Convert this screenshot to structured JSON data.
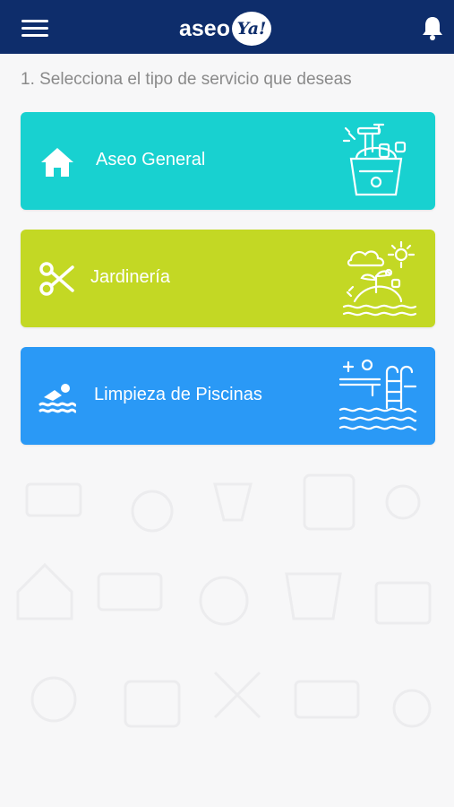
{
  "header": {
    "logo_text": "aseo",
    "logo_badge": "Ya!"
  },
  "main": {
    "heading": "1. Selecciona el tipo de servicio que deseas",
    "services": [
      {
        "label": "Aseo General",
        "color": "#18d1d0",
        "icon": "home-icon"
      },
      {
        "label": "Jardinería",
        "color": "#c3d824",
        "icon": "scissors-icon"
      },
      {
        "label": "Limpieza de Piscinas",
        "color": "#2a99f6",
        "icon": "swimmer-icon"
      }
    ]
  },
  "colors": {
    "topbar": "#0e2d6b",
    "background": "#f7f7f8",
    "heading_text": "#8a8a8a"
  }
}
